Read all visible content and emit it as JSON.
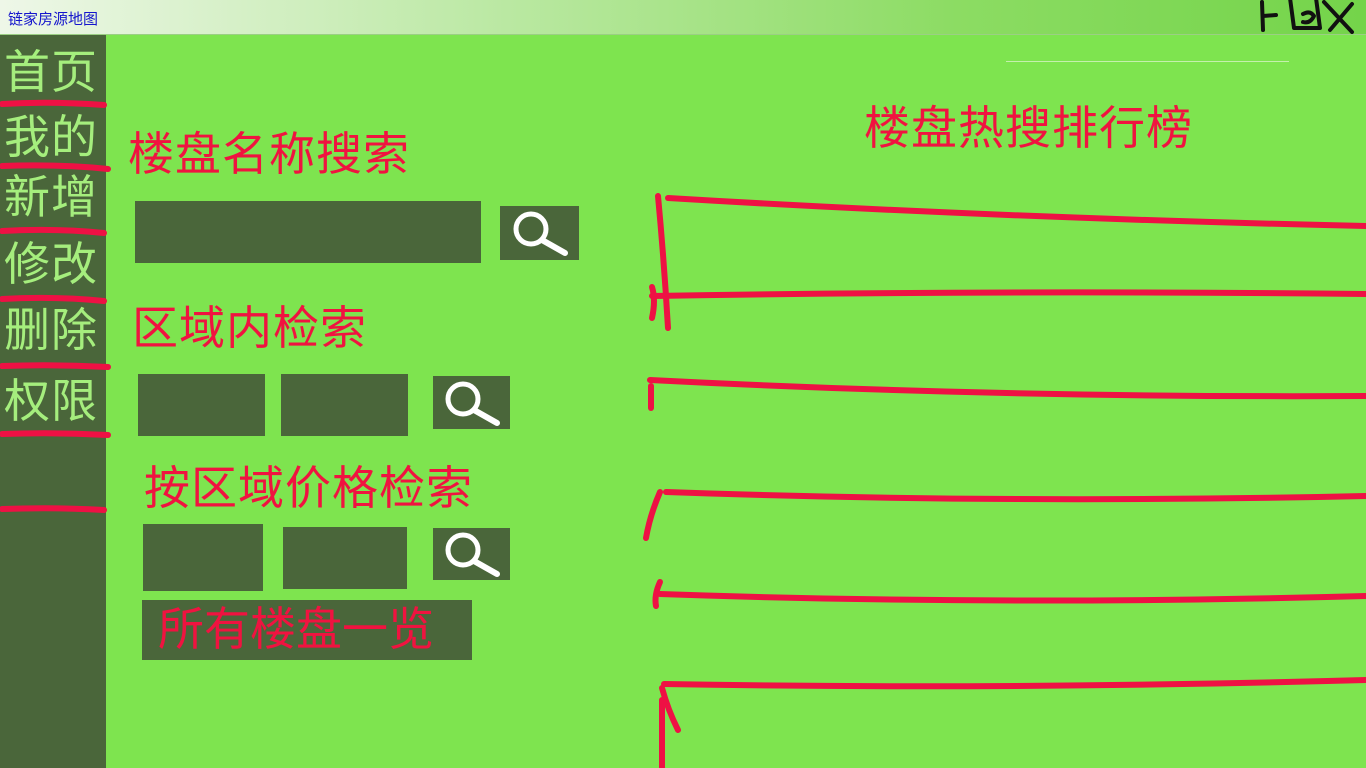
{
  "window": {
    "title": "链家房源地图"
  },
  "sidebar": {
    "items": [
      {
        "label": "首页"
      },
      {
        "label": "我的"
      },
      {
        "label": "新增"
      },
      {
        "label": "修改"
      },
      {
        "label": "删除"
      },
      {
        "label": "权限"
      }
    ]
  },
  "name_search": {
    "heading": "楼盘名称搜索",
    "input_value": "",
    "button_icon": "search-icon"
  },
  "district_search": {
    "heading": "区域内检索",
    "input1_value": "",
    "input2_value": "",
    "button_icon": "search-icon"
  },
  "price_search": {
    "heading": "按区域价格检索",
    "input1_value": "",
    "input2_value": "",
    "button_icon": "search-icon"
  },
  "all_listings": {
    "label": "所有楼盘一览"
  },
  "ranking": {
    "heading": "楼盘热搜排行榜"
  },
  "colors": {
    "background": "#7ee44f",
    "sidebar": "#4a663a",
    "nav_text": "#a5ee7d",
    "heading_text": "#f01340",
    "annotation_red": "#ee1144"
  }
}
